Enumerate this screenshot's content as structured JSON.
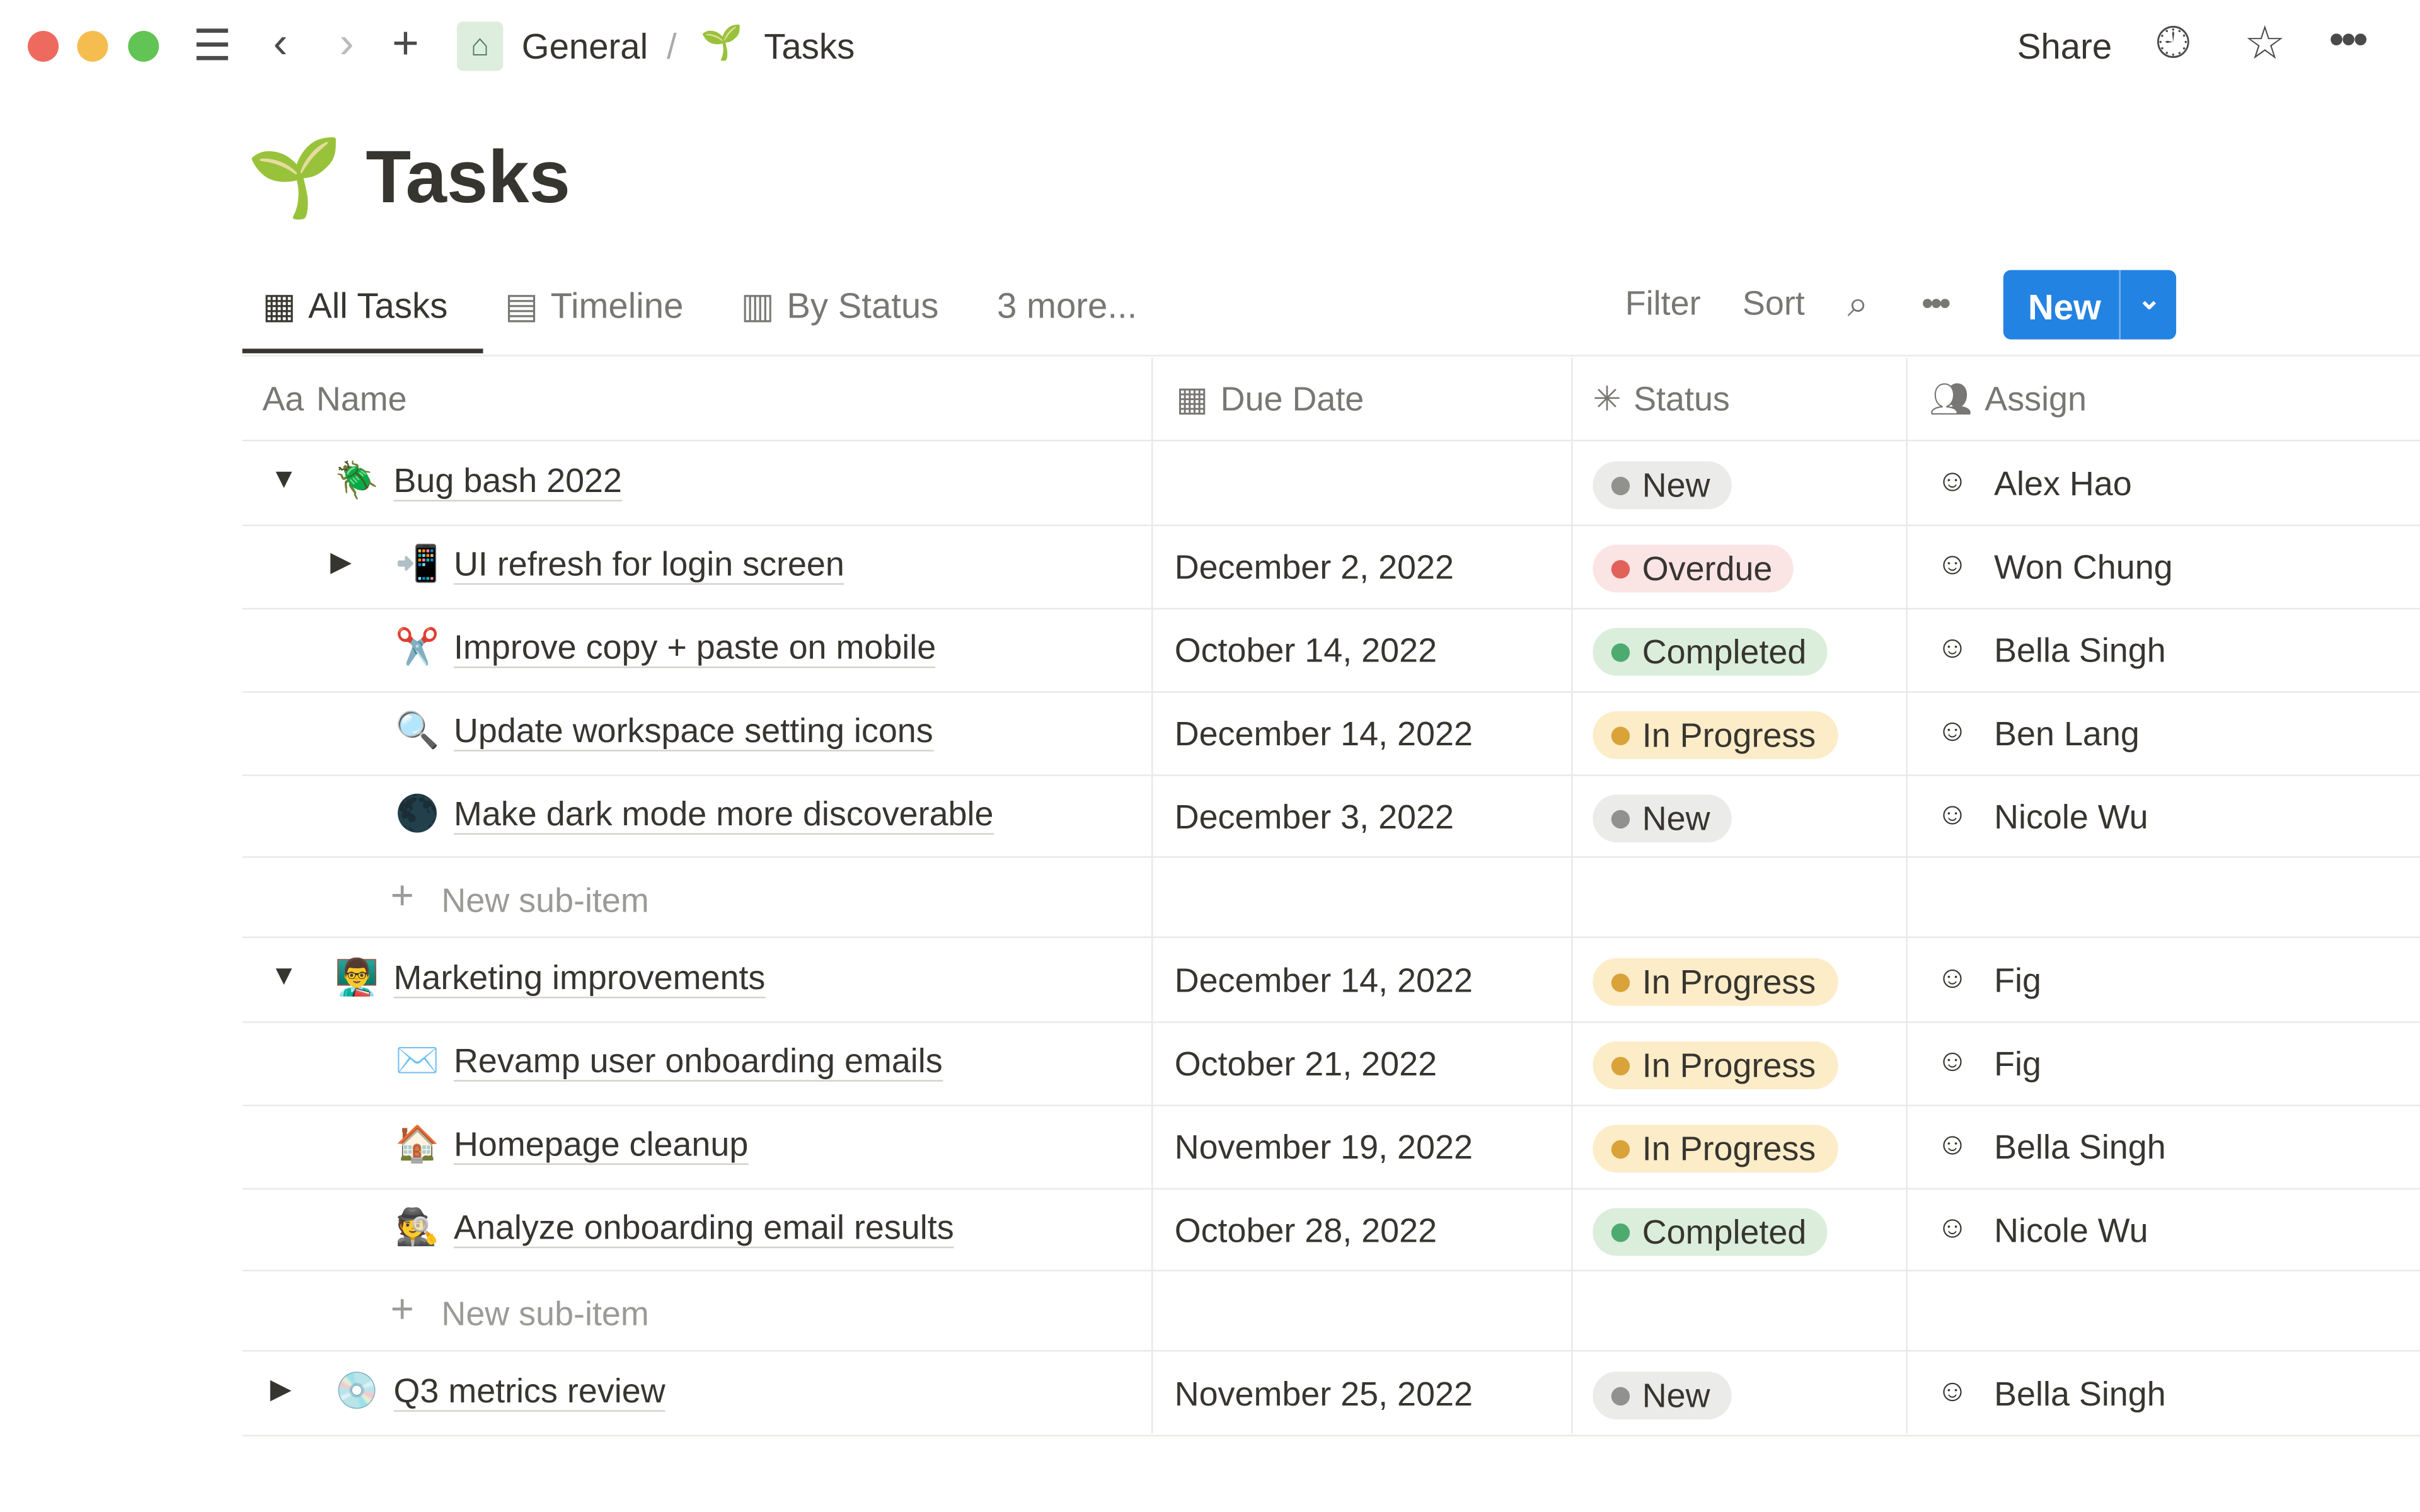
{
  "topbar": {
    "breadcrumb": [
      {
        "label": "General",
        "icon": "house-icon"
      },
      {
        "label": "Tasks",
        "icon": "seedling-icon"
      }
    ],
    "share": "Share",
    "new_tab_icon": "plus-icon"
  },
  "page": {
    "title": "Tasks",
    "icon": "seedling-icon"
  },
  "views": {
    "tabs": [
      {
        "label": "All Tasks",
        "icon": "table-icon"
      },
      {
        "label": "Timeline",
        "icon": "timeline-icon"
      },
      {
        "label": "By Status",
        "icon": "board-icon"
      }
    ],
    "more": "3 more...",
    "filter": "Filter",
    "sort": "Sort",
    "new": "New"
  },
  "columns": {
    "name": "Name",
    "name_icon": "Aa",
    "due": "Due Date",
    "status": "Status",
    "assign": "Assign"
  },
  "status_colors": {
    "New": "#91918e",
    "Overdue": "#e16259",
    "Completed": "#4dab6f",
    "In Progress": "#d9a33a"
  },
  "status_bg": {
    "New": "#ebebea",
    "Overdue": "#fbe4e4",
    "Completed": "#dbeddb",
    "In Progress": "#fdecc8"
  },
  "rows": [
    {
      "level": 0,
      "caret": "▼",
      "emoji": "🪲",
      "name": "Bug bash 2022",
      "due": "",
      "status": "New",
      "assign": "Alex Hao"
    },
    {
      "level": 1,
      "caret": "▶",
      "emoji": "📲",
      "name": "UI refresh for login screen",
      "due": "December 2, 2022",
      "status": "Overdue",
      "assign": "Won Chung"
    },
    {
      "level": 1,
      "emoji": "✂️",
      "name": "Improve copy + paste on mobile",
      "due": "October 14, 2022",
      "status": "Completed",
      "assign": "Bella Singh"
    },
    {
      "level": 1,
      "emoji": "🔍",
      "name": "Update workspace setting icons",
      "due": "December 14, 2022",
      "status": "In Progress",
      "assign": "Ben Lang"
    },
    {
      "level": 1,
      "emoji": "🌑",
      "name": "Make dark mode more discoverable",
      "due": "December 3, 2022",
      "status": "New",
      "assign": "Nicole Wu"
    },
    {
      "sub": true,
      "label": "New sub-item"
    },
    {
      "level": 0,
      "caret": "▼",
      "emoji": "👨‍🏫",
      "name": "Marketing improvements",
      "due": "December 14, 2022",
      "status": "In Progress",
      "assign": "Fig"
    },
    {
      "level": 1,
      "emoji": "✉️",
      "name": "Revamp user onboarding emails",
      "due": "October 21, 2022",
      "status": "In Progress",
      "assign": "Fig"
    },
    {
      "level": 1,
      "emoji": "🏠",
      "name": "Homepage cleanup",
      "due": "November 19, 2022",
      "status": "In Progress",
      "assign": "Bella Singh"
    },
    {
      "level": 1,
      "emoji": "🕵️",
      "name": "Analyze onboarding email results",
      "due": "October 28, 2022",
      "status": "Completed",
      "assign": "Nicole Wu"
    },
    {
      "sub": true,
      "label": "New sub-item"
    },
    {
      "level": 0,
      "caret": "▶",
      "emoji": "💿",
      "name": "Q3 metrics review",
      "due": "November 25, 2022",
      "status": "New",
      "assign": "Bella Singh"
    }
  ]
}
